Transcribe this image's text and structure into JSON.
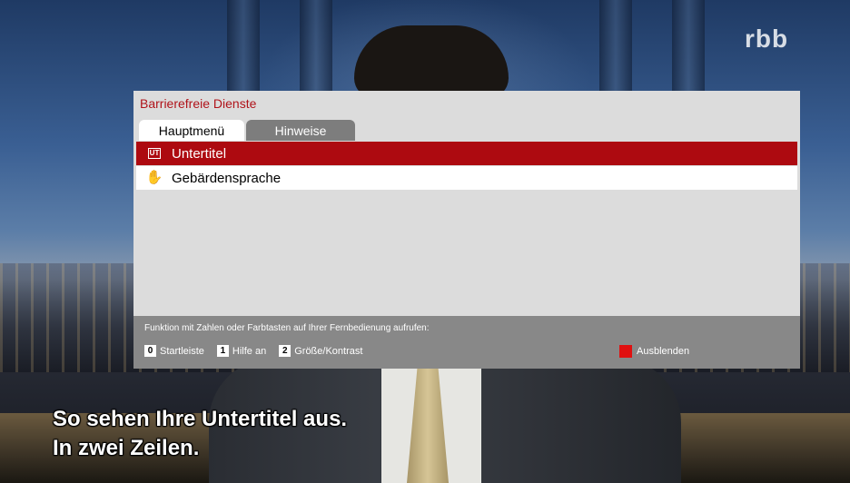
{
  "channel": {
    "logo": "rbb"
  },
  "dialog": {
    "title": "Barrierefreie Dienste",
    "tabs": [
      {
        "label": "Hauptmenü",
        "active": true
      },
      {
        "label": "Hinweise",
        "active": false
      }
    ],
    "items": [
      {
        "label": "Untertitel",
        "icon": "subtitle-ut-icon",
        "icon_text": "UT",
        "selected": true
      },
      {
        "label": "Gebärdensprache",
        "icon": "sign-language-hand-icon",
        "selected": false
      }
    ],
    "footer": {
      "instruction": "Funktion mit Zahlen oder Farbtasten auf Ihrer Fernbedienung aufrufen:",
      "keys": [
        {
          "key": "0",
          "label": "Startleiste"
        },
        {
          "key": "1",
          "label": "Hilfe an"
        },
        {
          "key": "2",
          "label": "Größe/Kontrast"
        }
      ],
      "color_key": {
        "color": "#e01010",
        "label": "Ausblenden"
      }
    }
  },
  "subtitles": [
    "So sehen Ihre Untertitel aus.",
    "In zwei Zeilen."
  ],
  "colors": {
    "accent": "#ad0a10",
    "title": "#b0131a",
    "panel": "#dcdcdc",
    "footer": "#888888"
  }
}
